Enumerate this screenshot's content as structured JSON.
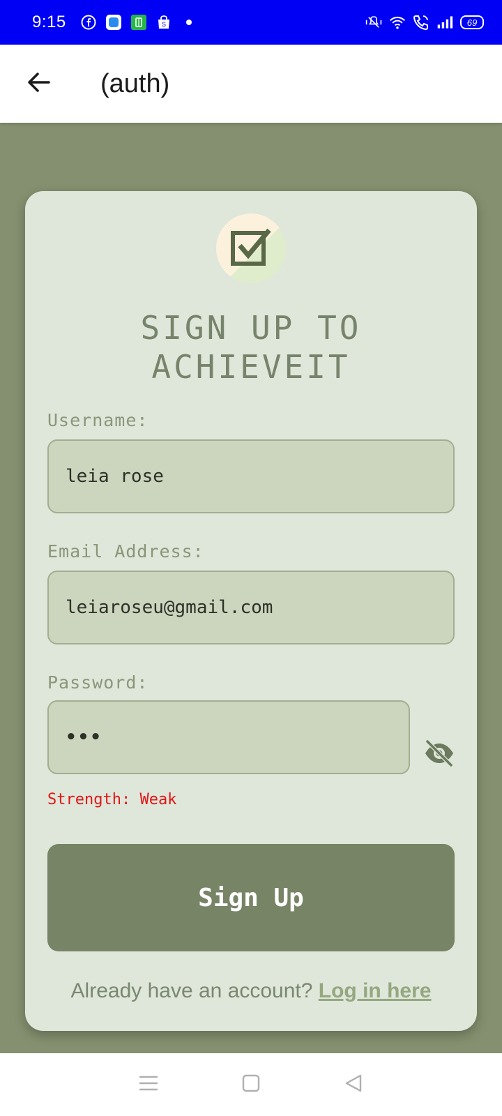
{
  "status_bar": {
    "time": "9:15",
    "battery": "69",
    "left_icons": [
      "facebook-icon",
      "app-icon-blue",
      "app-icon-green",
      "shopping-bag-icon",
      "dot-icon"
    ],
    "right_icons": [
      "mute-vibrate-icon",
      "wifi-icon",
      "wifi-calling-icon",
      "signal-icon",
      "battery-icon"
    ]
  },
  "app_bar": {
    "title": "(auth)",
    "back_icon": "arrow-left-icon"
  },
  "card": {
    "logo_icon": "checkbox-icon",
    "title": "SIGN UP TO\nACHIEVEIT",
    "username": {
      "label": "Username:",
      "value": "leia rose"
    },
    "email": {
      "label": "Email Address:",
      "value": "leiaroseu@gmail.com"
    },
    "password": {
      "label": "Password:",
      "value": "•••",
      "toggle_icon": "eye-off-icon"
    },
    "strength": "Strength: Weak",
    "signup_button": "Sign Up",
    "login_prompt": "Already have an account?",
    "login_link": "Log in here"
  },
  "nav_bar": {
    "icons": [
      "menu-icon",
      "home-square-icon",
      "back-triangle-icon"
    ]
  },
  "colors": {
    "status_bar": "#0000f5",
    "background": "#84906f",
    "card": "#dfe6da",
    "input": "#ccd5bd",
    "button": "#778466",
    "title": "#77836a",
    "strength_weak": "#e21515",
    "link": "#95a77f"
  }
}
